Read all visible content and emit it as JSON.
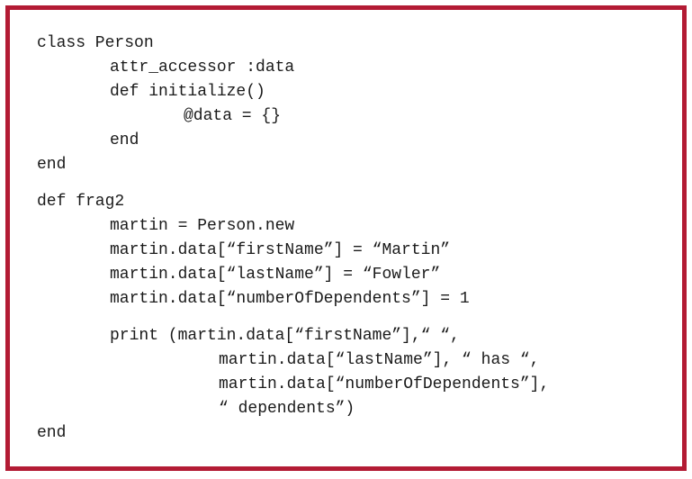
{
  "code_listing": {
    "lines": [
      "class Person",
      "attr_accessor :data",
      "def initialize()",
      "@data = {}",
      "end",
      "end",
      "def frag2",
      "martin = Person.new",
      "martin.data[“firstName”] = “Martin”",
      "martin.data[“lastName”] = “Fowler”",
      "martin.data[“numberOfDependents”] = 1",
      "print (martin.data[“firstName”],“ “,",
      "martin.data[“lastName”], “ has “,",
      "martin.data[“numberOfDependents”],",
      "“ dependents”)",
      "end"
    ]
  },
  "colors": {
    "border": "#b31b34",
    "text": "#1a1a1a",
    "background": "#ffffff"
  }
}
